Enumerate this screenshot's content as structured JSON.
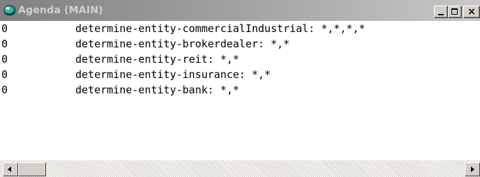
{
  "window": {
    "title": "Agenda (MAIN)",
    "close_glyph": "×",
    "icon": "clips-app-icon"
  },
  "agenda": {
    "rows": [
      {
        "priority": "0",
        "text": "determine-entity-commercialIndustrial: *,*,*,*"
      },
      {
        "priority": "0",
        "text": "determine-entity-brokerdealer: *,*"
      },
      {
        "priority": "0",
        "text": "determine-entity-reit: *,*"
      },
      {
        "priority": "0",
        "text": "determine-entity-insurance: *,*"
      },
      {
        "priority": "0",
        "text": "determine-entity-bank: *,*"
      }
    ]
  },
  "colors": {
    "titlebar_start": "#808080",
    "titlebar_end": "#c8c8c8",
    "face": "#d4d0c8",
    "content_bg": "#ffffff"
  }
}
